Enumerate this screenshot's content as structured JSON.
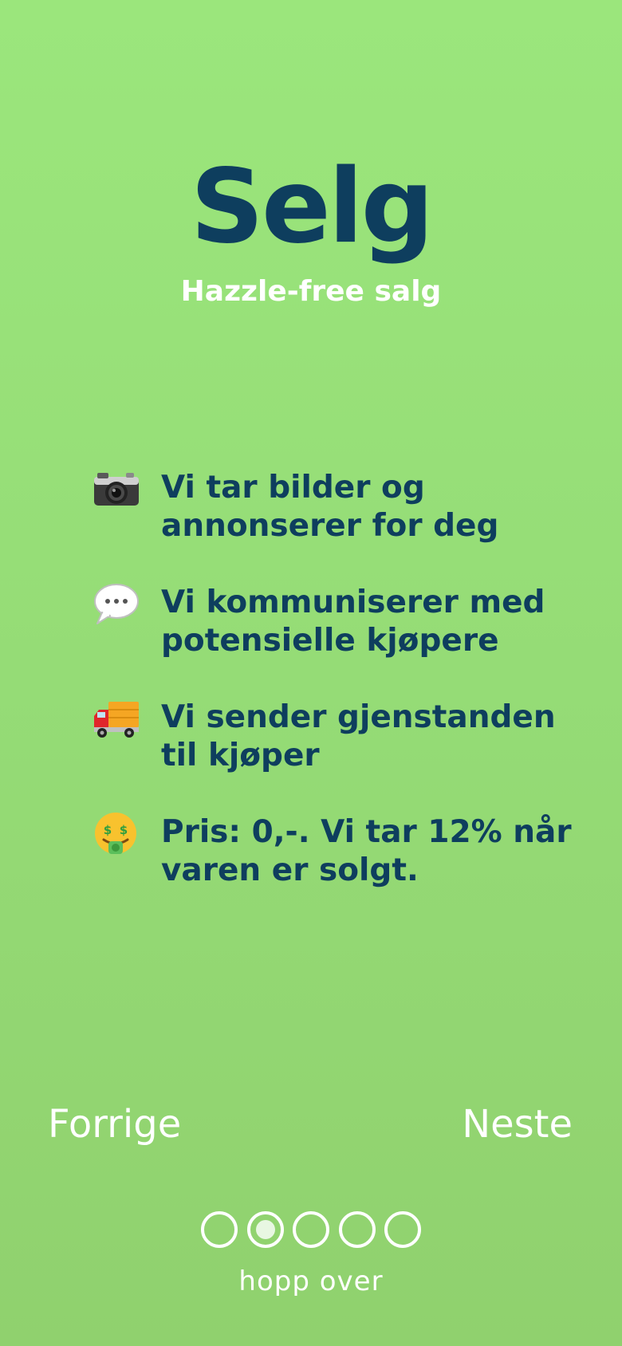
{
  "header": {
    "title": "Selg",
    "subtitle": "Hazzle-free salg"
  },
  "features": [
    {
      "icon": "camera-icon",
      "text": "Vi tar bilder og annonserer for deg"
    },
    {
      "icon": "speech-bubble-icon",
      "text": "Vi kommuniserer med potensielle kjøpere"
    },
    {
      "icon": "delivery-truck-icon",
      "text": "Vi sender gjenstanden til kjøper"
    },
    {
      "icon": "money-mouth-face-icon",
      "text": "Pris: 0,-. Vi tar 12% når varen er solgt."
    }
  ],
  "navigation": {
    "prev_label": "Forrige",
    "next_label": "Neste",
    "skip_label": "hopp over"
  },
  "pagination": {
    "total": 5,
    "current": 2
  },
  "colors": {
    "background": "#98e07a",
    "title": "#0e3e5e",
    "text": "#0e3e5e",
    "light": "#ffffff"
  }
}
